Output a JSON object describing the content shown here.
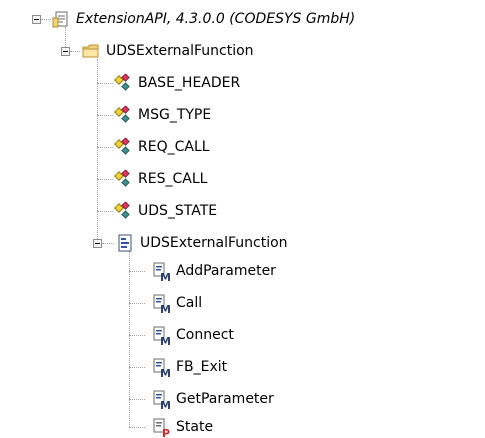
{
  "tree": {
    "root": {
      "label": "ExtensionAPI, 4.3.0.0 (CODESYS GmbH)",
      "icon": "library-document-icon"
    },
    "folder": {
      "label": "UDSExternalFunction",
      "icon": "folder-icon"
    },
    "types": [
      {
        "label": "BASE_HEADER",
        "icon": "struct-type-icon"
      },
      {
        "label": "MSG_TYPE",
        "icon": "struct-type-icon"
      },
      {
        "label": "REQ_CALL",
        "icon": "struct-type-icon"
      },
      {
        "label": "RES_CALL",
        "icon": "struct-type-icon"
      },
      {
        "label": "UDS_STATE",
        "icon": "struct-type-icon"
      }
    ],
    "function_block": {
      "label": "UDSExternalFunction",
      "icon": "function-block-icon"
    },
    "members": [
      {
        "label": "AddParameter",
        "icon": "method-icon"
      },
      {
        "label": "Call",
        "icon": "method-icon"
      },
      {
        "label": "Connect",
        "icon": "method-icon"
      },
      {
        "label": "FB_Exit",
        "icon": "method-icon"
      },
      {
        "label": "GetParameter",
        "icon": "method-icon"
      },
      {
        "label": "State",
        "icon": "property-icon"
      }
    ]
  }
}
